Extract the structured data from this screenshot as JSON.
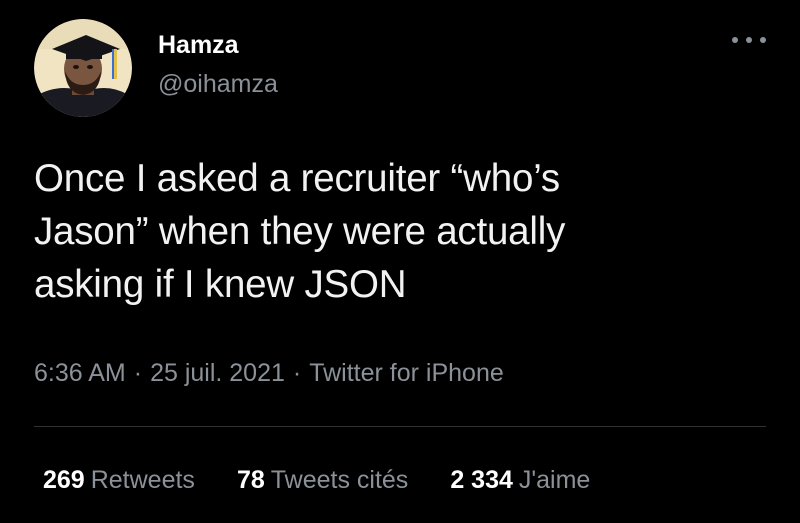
{
  "tweet": {
    "author": {
      "display_name": "Hamza",
      "handle": "@oihamza",
      "avatar_icon": "avatar-photo-icon"
    },
    "more_icon": "more-options-icon",
    "text_lines": [
      "Once I asked a recruiter “who’s",
      "Jason” when they were actually",
      "asking if I knew JSON"
    ],
    "meta": {
      "time": "6:36 AM",
      "separator": "·",
      "date": "25 juil. 2021",
      "source": "Twitter for iPhone"
    },
    "stats": {
      "retweets_count": "269",
      "retweets_label": "Retweets",
      "quotes_count": "78",
      "quotes_label": "Tweets cités",
      "likes_count": "2 334",
      "likes_label": "J'aime"
    }
  },
  "colors": {
    "background": "#000000",
    "primary_text": "#ffffff",
    "secondary_text": "#8b9198",
    "divider": "#2f3336",
    "avatar_ring": "#f5e6b8",
    "graduation_tassel": "#3c6fd6"
  }
}
